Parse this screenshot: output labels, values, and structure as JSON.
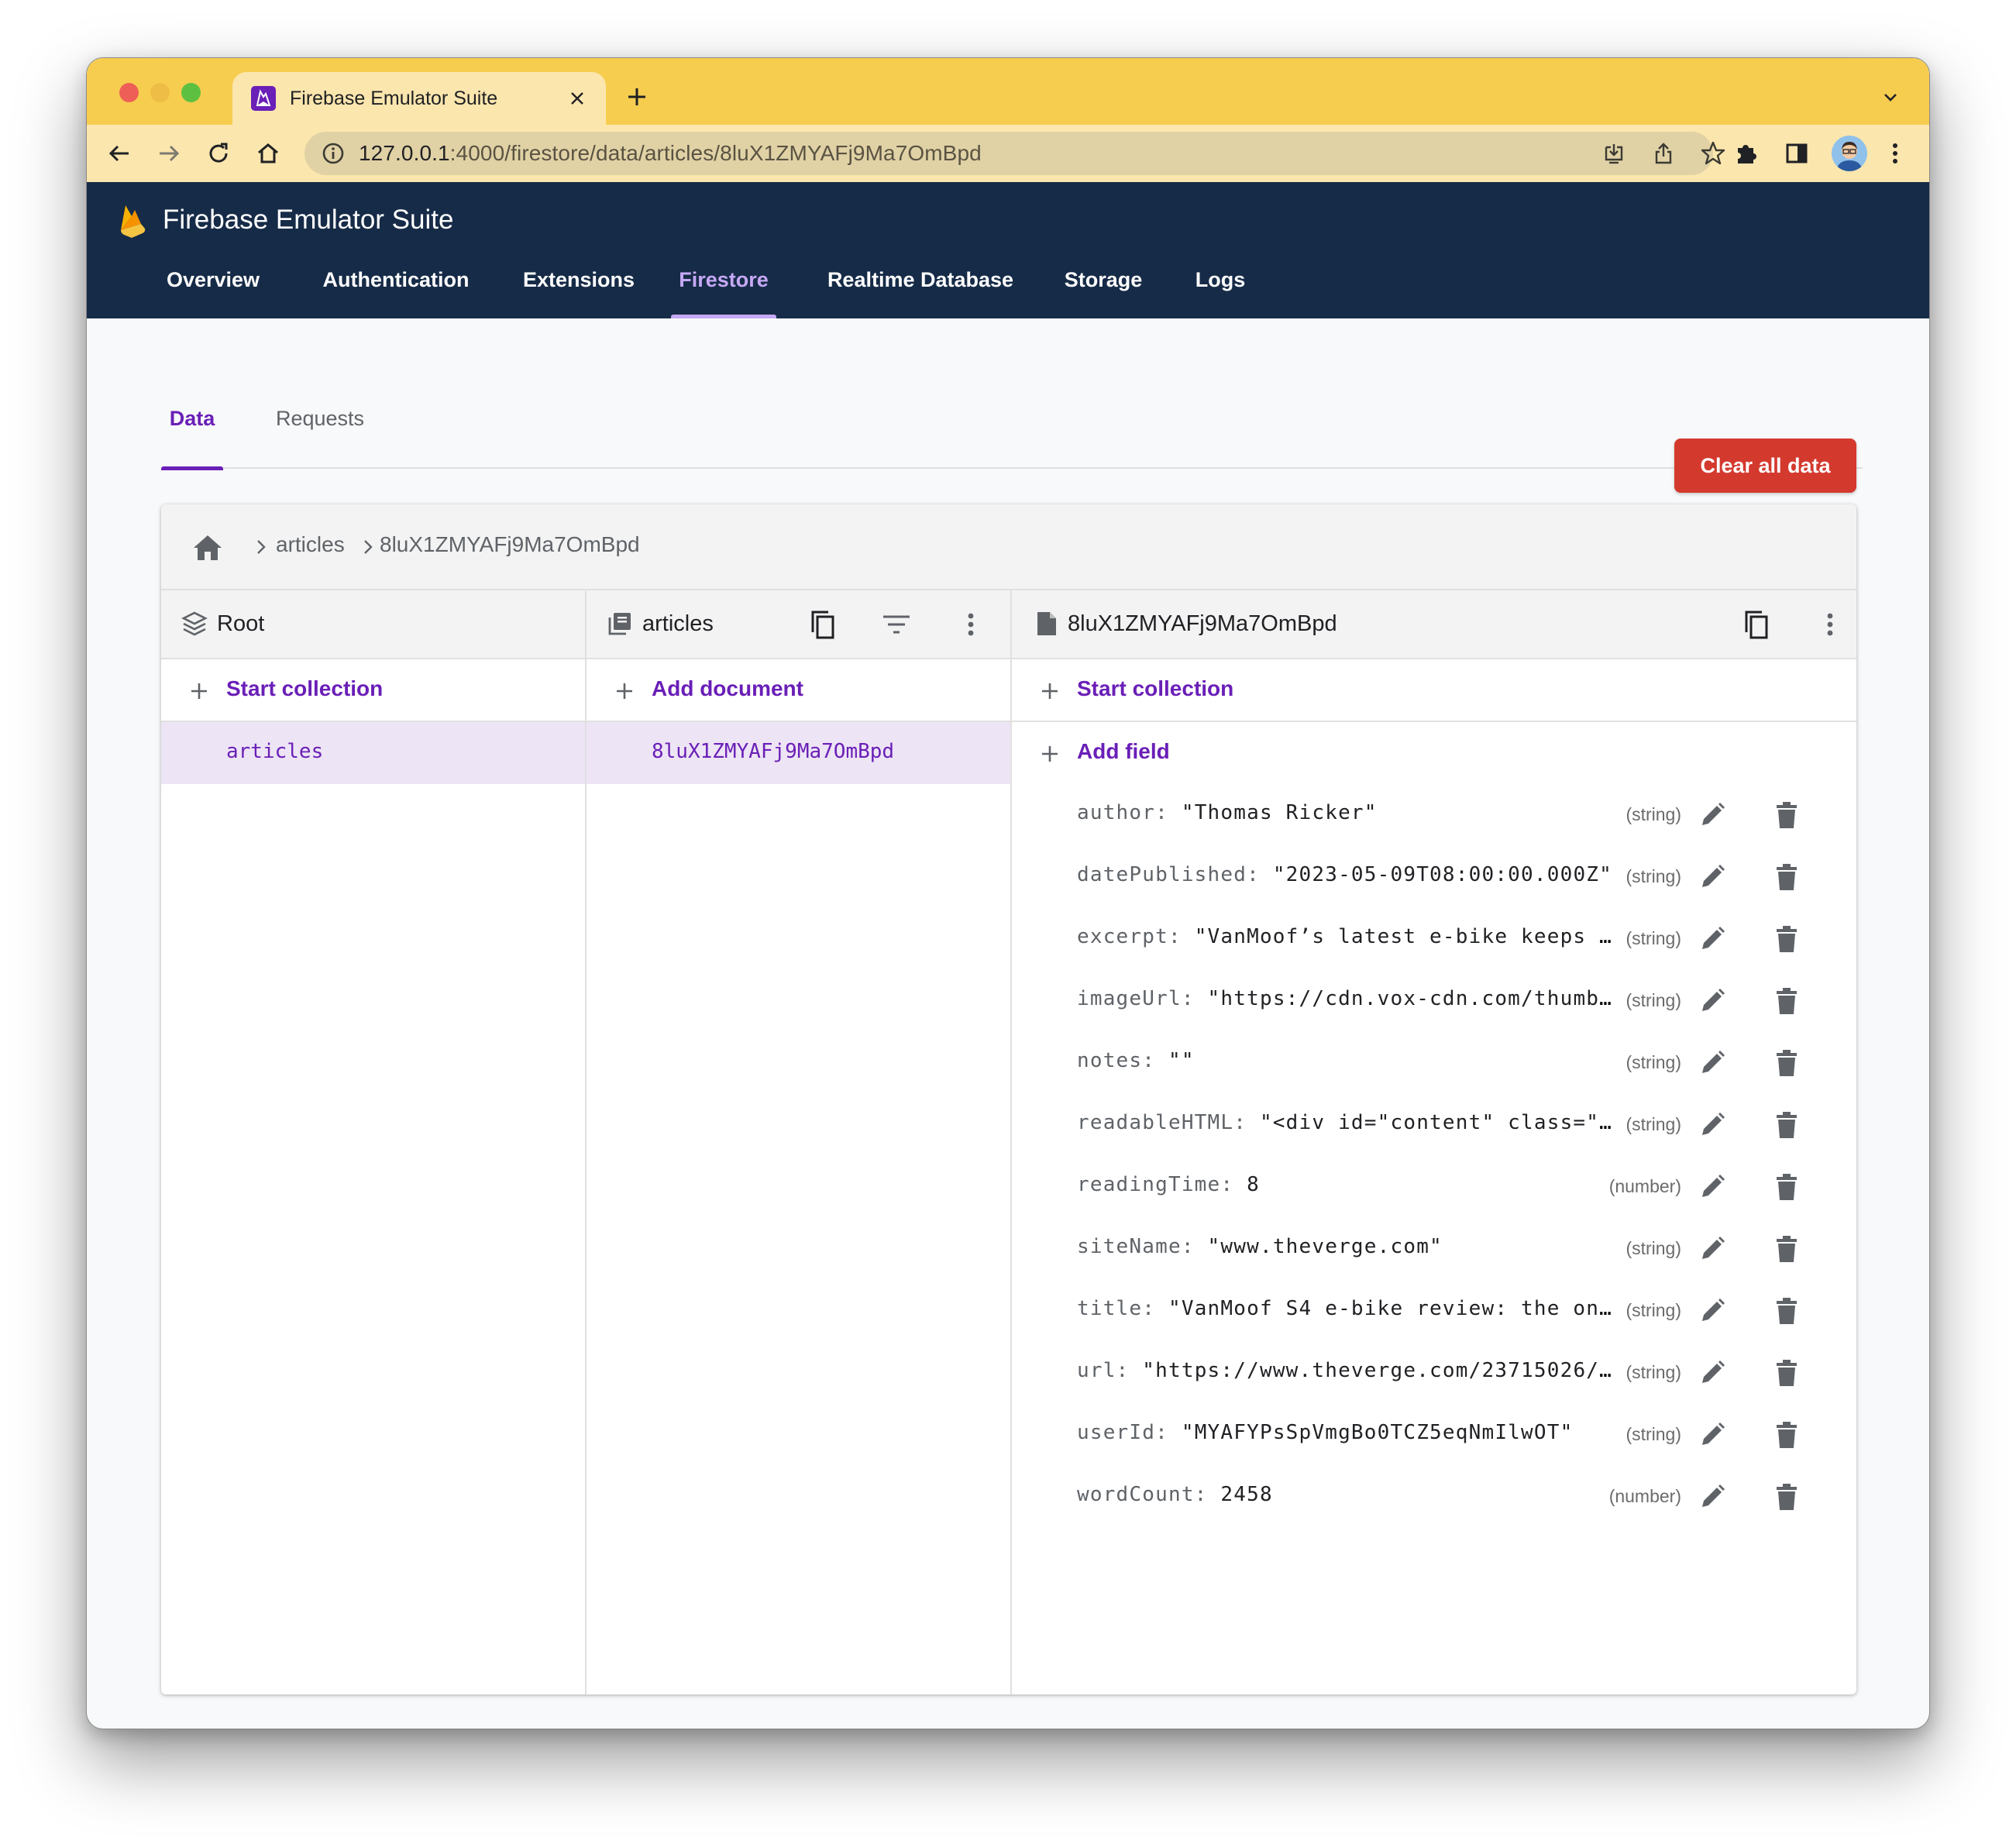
{
  "browser": {
    "tab_title": "Firebase Emulator Suite",
    "url_host": "127.0.0.1",
    "url_rest": ":4000/firestore/data/articles/8luX1ZMYAFj9Ma7OmBpd"
  },
  "app": {
    "title": "Firebase Emulator Suite",
    "nav": [
      {
        "label": "Overview"
      },
      {
        "label": "Authentication"
      },
      {
        "label": "Extensions"
      },
      {
        "label": "Firestore",
        "active": true
      },
      {
        "label": "Realtime Database"
      },
      {
        "label": "Storage"
      },
      {
        "label": "Logs"
      }
    ],
    "subtabs": [
      {
        "label": "Data",
        "active": true
      },
      {
        "label": "Requests"
      }
    ],
    "clear_button": "Clear all data",
    "accent_color": "#6a1fb7",
    "header_color": "#162b47",
    "danger_color": "#d4392e"
  },
  "breadcrumb": [
    "articles",
    "8luX1ZMYAFj9Ma7OmBpd"
  ],
  "columns": {
    "root": {
      "title": "Root",
      "action": "Start collection",
      "items": [
        "articles"
      ]
    },
    "collection": {
      "title": "articles",
      "action": "Add document",
      "items": [
        "8luX1ZMYAFj9Ma7OmBpd"
      ]
    },
    "document": {
      "title": "8luX1ZMYAFj9Ma7OmBpd",
      "action_collection": "Start collection",
      "action_field": "Add field",
      "fields": [
        {
          "key": "author:",
          "value": "\"Thomas Ricker\"",
          "type": "(string)"
        },
        {
          "key": "datePublished:",
          "value": "\"2023-05-09T08:00:00.000Z\"",
          "type": "(string)"
        },
        {
          "key": "excerpt:",
          "value": "\"VanMoof’s latest e-bike keeps it …",
          "type": "(string)"
        },
        {
          "key": "imageUrl:",
          "value": "\"https://cdn.vox-cdn.com/thumbor/…",
          "type": "(string)"
        },
        {
          "key": "notes:",
          "value": "\"\"",
          "type": "(string)"
        },
        {
          "key": "readableHTML:",
          "value": "\"<div id=\"content\" class=\"cle…",
          "type": "(string)"
        },
        {
          "key": "readingTime:",
          "value": "8",
          "type": "(number)"
        },
        {
          "key": "siteName:",
          "value": "\"www.theverge.com\"",
          "type": "(string)"
        },
        {
          "key": "title:",
          "value": "\"VanMoof S4 e-bike review: the one t…",
          "type": "(string)"
        },
        {
          "key": "url:",
          "value": "\"https://www.theverge.com/23715026/van…",
          "type": "(string)"
        },
        {
          "key": "userId:",
          "value": "\"MYAFYPsSpVmgBo0TCZ5eqNmIlwOT\"",
          "type": "(string)"
        },
        {
          "key": "wordCount:",
          "value": "2458",
          "type": "(number)"
        }
      ]
    }
  }
}
